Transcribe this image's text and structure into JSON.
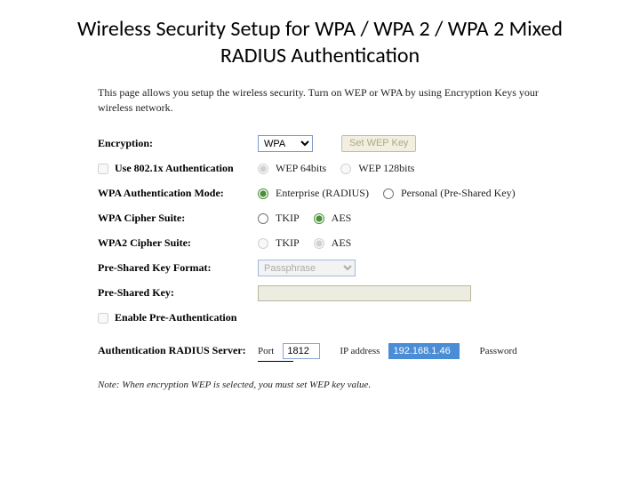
{
  "title": "Wireless Security Setup for WPA / WPA 2 / WPA 2 Mixed RADIUS Authentication",
  "intro": "This page allows you setup the wireless security. Turn on WEP or WPA by using Encryption Keys your wireless network.",
  "labels": {
    "encryption": "Encryption:",
    "setwep": "Set WEP Key",
    "use8021x": "Use 802.1x Authentication",
    "wep64": "WEP 64bits",
    "wep128": "WEP 128bits",
    "authmode": "WPA Authentication Mode:",
    "enterprise": "Enterprise (RADIUS)",
    "personal": "Personal (Pre-Shared Key)",
    "wpa_cipher": "WPA Cipher Suite:",
    "wpa2_cipher": "WPA2 Cipher Suite:",
    "tkip": "TKIP",
    "aes": "AES",
    "psk_format": "Pre-Shared Key Format:",
    "psk": "Pre-Shared Key:",
    "preauth": "Enable Pre-Authentication",
    "radius": "Authentication RADIUS Server:",
    "port": "Port",
    "ip": "IP address",
    "password": "Password"
  },
  "values": {
    "encryption": "WPA",
    "psk_format": "Passphrase",
    "radius_port": "1812",
    "radius_ip": "192.168.1.46"
  },
  "note": "Note: When encryption WEP is selected, you must set WEP key value."
}
